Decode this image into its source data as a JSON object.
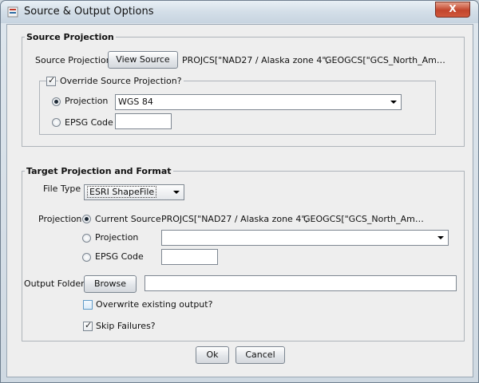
{
  "window": {
    "title": "Source & Output Options",
    "close_glyph": "X"
  },
  "source_projection": {
    "legend": "Source Projection",
    "label": "Source Projection",
    "view_button": "View Source",
    "wkt_projcs": "PROJCS[\"NAD27 / Alaska zone 4\",",
    "wkt_geogcs": "GEOGCS[\"GCS_North_Am…",
    "override": {
      "label": "Override Source Projection?",
      "checked": true,
      "projection_label": "Projection",
      "projection_value": "WGS 84",
      "epsg_label": "EPSG Code",
      "epsg_value": ""
    }
  },
  "target": {
    "legend": "Target Projection and Format",
    "file_type_label": "File Type",
    "file_type_value": "ESRI ShapeFile",
    "projection_label": "Projection",
    "current_source_label": "Current Source",
    "current_wkt_projcs": "PROJCS[\"NAD27 / Alaska zone 4\",",
    "current_wkt_geogcs": "GEOGCS[\"GCS_North_Am…",
    "projection_option_label": "Projection",
    "projection_value": "",
    "epsg_label": "EPSG Code",
    "epsg_value": "",
    "output_folder_label": "Output Folder",
    "browse_button": "Browse",
    "output_folder_value": "",
    "overwrite_label": "Overwrite existing output?",
    "overwrite_checked": false,
    "skip_failures_label": "Skip Failures?",
    "skip_failures_checked": true
  },
  "actions": {
    "ok": "Ok",
    "cancel": "Cancel"
  }
}
